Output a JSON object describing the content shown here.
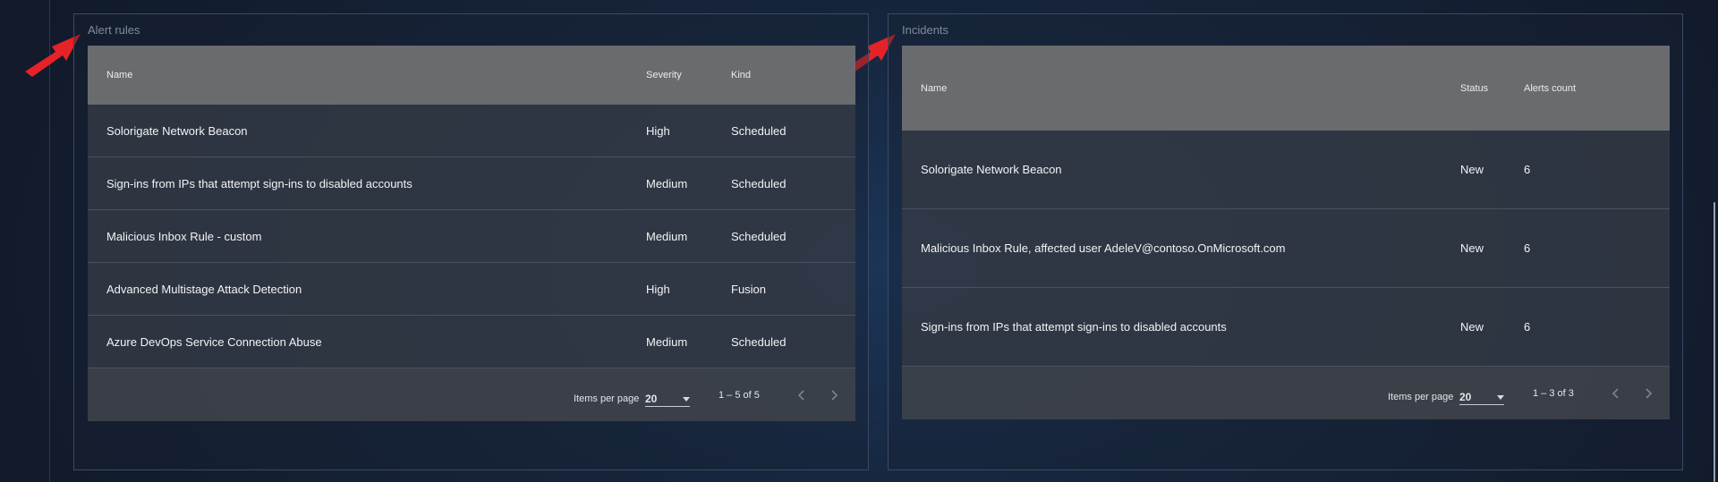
{
  "alert_rules": {
    "title": "Alert rules",
    "columns": {
      "name": "Name",
      "severity": "Severity",
      "kind": "Kind"
    },
    "rows": [
      {
        "name": "Solorigate Network Beacon",
        "severity": "High",
        "kind": "Scheduled"
      },
      {
        "name": "Sign-ins from IPs that attempt sign-ins to disabled accounts",
        "severity": "Medium",
        "kind": "Scheduled"
      },
      {
        "name": "Malicious Inbox Rule - custom",
        "severity": "Medium",
        "kind": "Scheduled"
      },
      {
        "name": "Advanced Multistage Attack Detection",
        "severity": "High",
        "kind": "Fusion"
      },
      {
        "name": "Azure DevOps Service Connection Abuse",
        "severity": "Medium",
        "kind": "Scheduled"
      }
    ],
    "paginator": {
      "items_per_page_label": "Items per page",
      "page_size": "20",
      "range_label": "1 – 5 of 5"
    }
  },
  "incidents": {
    "title": "Incidents",
    "columns": {
      "name": "Name",
      "status": "Status",
      "alerts_count": "Alerts count"
    },
    "rows": [
      {
        "name": "Solorigate Network Beacon",
        "status": "New",
        "alerts_count": "6"
      },
      {
        "name": "Malicious Inbox Rule, affected user AdeleV@contoso.OnMicrosoft.com",
        "status": "New",
        "alerts_count": "6"
      },
      {
        "name": "Sign-ins from IPs that attempt sign-ins to disabled accounts",
        "status": "New",
        "alerts_count": "6"
      }
    ],
    "paginator": {
      "items_per_page_label": "Items per page",
      "page_size": "20",
      "range_label": "1 – 3 of 3"
    }
  },
  "icons": {
    "prev_page": "chevron-left-icon",
    "next_page": "chevron-right-icon",
    "page_size_dropdown": "caret-down-icon",
    "annotation": "red-arrow-icon"
  },
  "colors": {
    "annotation_arrow": "#e52228",
    "header_row": "#6a6b6e",
    "body_row": "#343a45",
    "card_border": "#3b4a62"
  }
}
